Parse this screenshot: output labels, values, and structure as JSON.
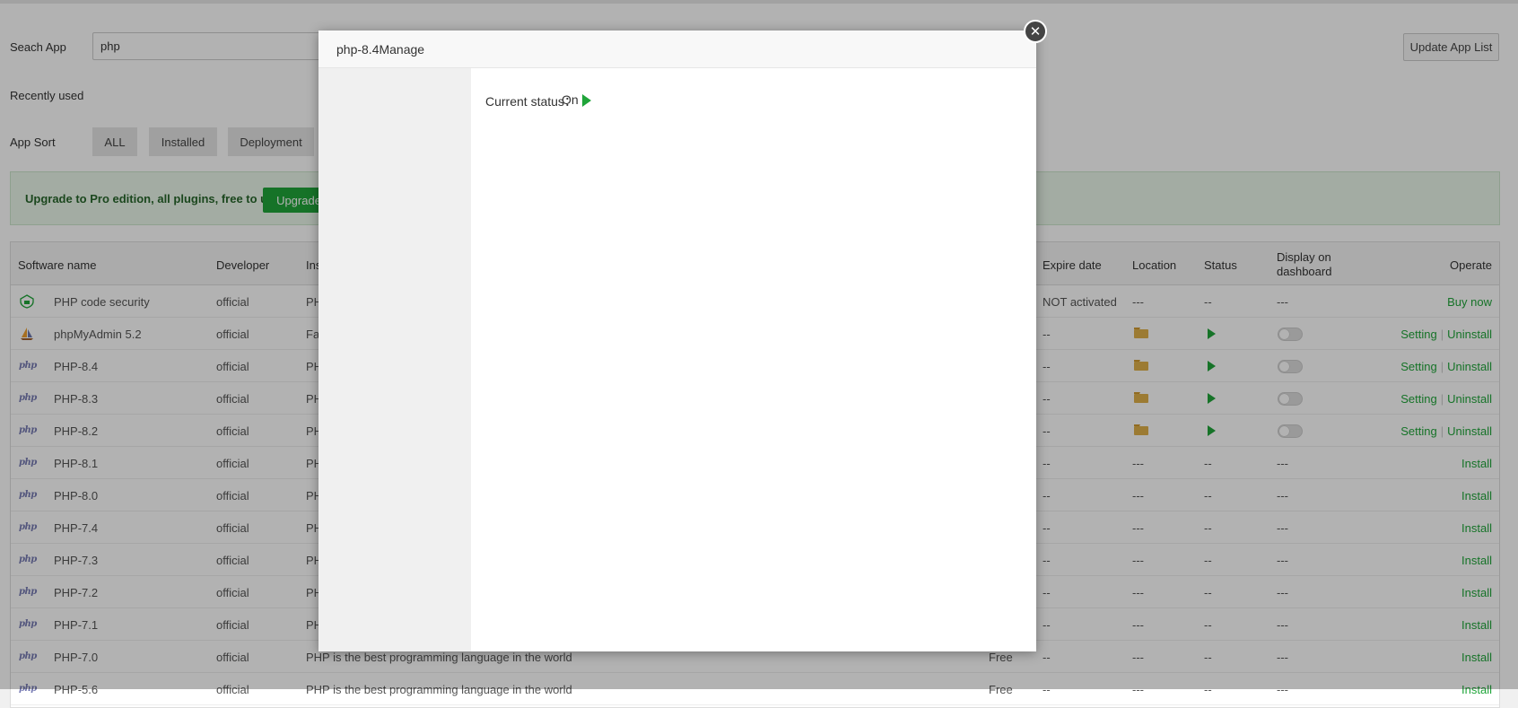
{
  "search": {
    "label": "Seach App",
    "value": "php"
  },
  "update_button": "Update App List",
  "recently_used": "Recently used",
  "app_sort": {
    "label": "App Sort",
    "buttons": [
      "ALL",
      "Installed",
      "Deployment"
    ]
  },
  "banner": {
    "text": "Upgrade to Pro edition, all plugins, free to use!",
    "button": "Upgrade"
  },
  "table": {
    "headers": {
      "name": "Software name",
      "developer": "Developer",
      "instructions": "Ins",
      "expire": "Expire date",
      "location": "Location",
      "status": "Status",
      "display_line1": "Display on",
      "display_line2": "dashboard",
      "operate": "Operate"
    },
    "rows": [
      {
        "name": "PHP code security",
        "developer": "official",
        "instructions": "PH",
        "price": "",
        "expire": "NOT activated",
        "location": "---",
        "status": "--",
        "display": "---",
        "operate": [
          "Buy now"
        ],
        "icon": "shield-icon"
      },
      {
        "name": "phpMyAdmin 5.2",
        "developer": "official",
        "instructions": "Far",
        "price": "",
        "expire": "--",
        "location": "folder",
        "status": "running",
        "display": "toggle",
        "operate": [
          "Setting",
          "Uninstall"
        ],
        "icon": "sailboat-icon"
      },
      {
        "name": "PHP-8.4",
        "developer": "official",
        "instructions": "PH",
        "price": "",
        "expire": "--",
        "location": "folder",
        "status": "running",
        "display": "toggle",
        "operate": [
          "Setting",
          "Uninstall"
        ],
        "icon": "php-icon"
      },
      {
        "name": "PHP-8.3",
        "developer": "official",
        "instructions": "PH",
        "price": "",
        "expire": "--",
        "location": "folder",
        "status": "running",
        "display": "toggle",
        "operate": [
          "Setting",
          "Uninstall"
        ],
        "icon": "php-icon"
      },
      {
        "name": "PHP-8.2",
        "developer": "official",
        "instructions": "PH",
        "price": "",
        "expire": "--",
        "location": "folder",
        "status": "running",
        "display": "toggle",
        "operate": [
          "Setting",
          "Uninstall"
        ],
        "icon": "php-icon"
      },
      {
        "name": "PHP-8.1",
        "developer": "official",
        "instructions": "PH",
        "price": "",
        "expire": "--",
        "location": "---",
        "status": "--",
        "display": "---",
        "operate": [
          "Install"
        ],
        "icon": "php-icon"
      },
      {
        "name": "PHP-8.0",
        "developer": "official",
        "instructions": "PH",
        "price": "",
        "expire": "--",
        "location": "---",
        "status": "--",
        "display": "---",
        "operate": [
          "Install"
        ],
        "icon": "php-icon"
      },
      {
        "name": "PHP-7.4",
        "developer": "official",
        "instructions": "PH",
        "price": "",
        "expire": "--",
        "location": "---",
        "status": "--",
        "display": "---",
        "operate": [
          "Install"
        ],
        "icon": "php-icon"
      },
      {
        "name": "PHP-7.3",
        "developer": "official",
        "instructions": "PH",
        "price": "",
        "expire": "--",
        "location": "---",
        "status": "--",
        "display": "---",
        "operate": [
          "Install"
        ],
        "icon": "php-icon"
      },
      {
        "name": "PHP-7.2",
        "developer": "official",
        "instructions": "PH",
        "price": "",
        "expire": "--",
        "location": "---",
        "status": "--",
        "display": "---",
        "operate": [
          "Install"
        ],
        "icon": "php-icon"
      },
      {
        "name": "PHP-7.1",
        "developer": "official",
        "instructions": "PH",
        "price": "",
        "expire": "--",
        "location": "---",
        "status": "--",
        "display": "---",
        "operate": [
          "Install"
        ],
        "icon": "php-icon"
      },
      {
        "name": "PHP-7.0",
        "developer": "official",
        "instructions": "PHP is the best programming language in the world",
        "price": "Free",
        "expire": "--",
        "location": "---",
        "status": "--",
        "display": "---",
        "operate": [
          "Install"
        ],
        "icon": "php-icon"
      },
      {
        "name": "PHP-5.6",
        "developer": "official",
        "instructions": "PHP is the best programming language in the world",
        "price": "Free",
        "expire": "--",
        "location": "---",
        "status": "--",
        "display": "---",
        "operate": [
          "Install"
        ],
        "icon": "php-icon"
      }
    ]
  },
  "modal": {
    "title": "php-8.4Manage",
    "status_label": "Current status：",
    "status_value": "On",
    "close": "✕"
  },
  "colors": {
    "accent": "#20a53a",
    "banner_bg": "#eaf7ea",
    "folder": "#e0b04a",
    "php_icon": "#777bb3"
  }
}
